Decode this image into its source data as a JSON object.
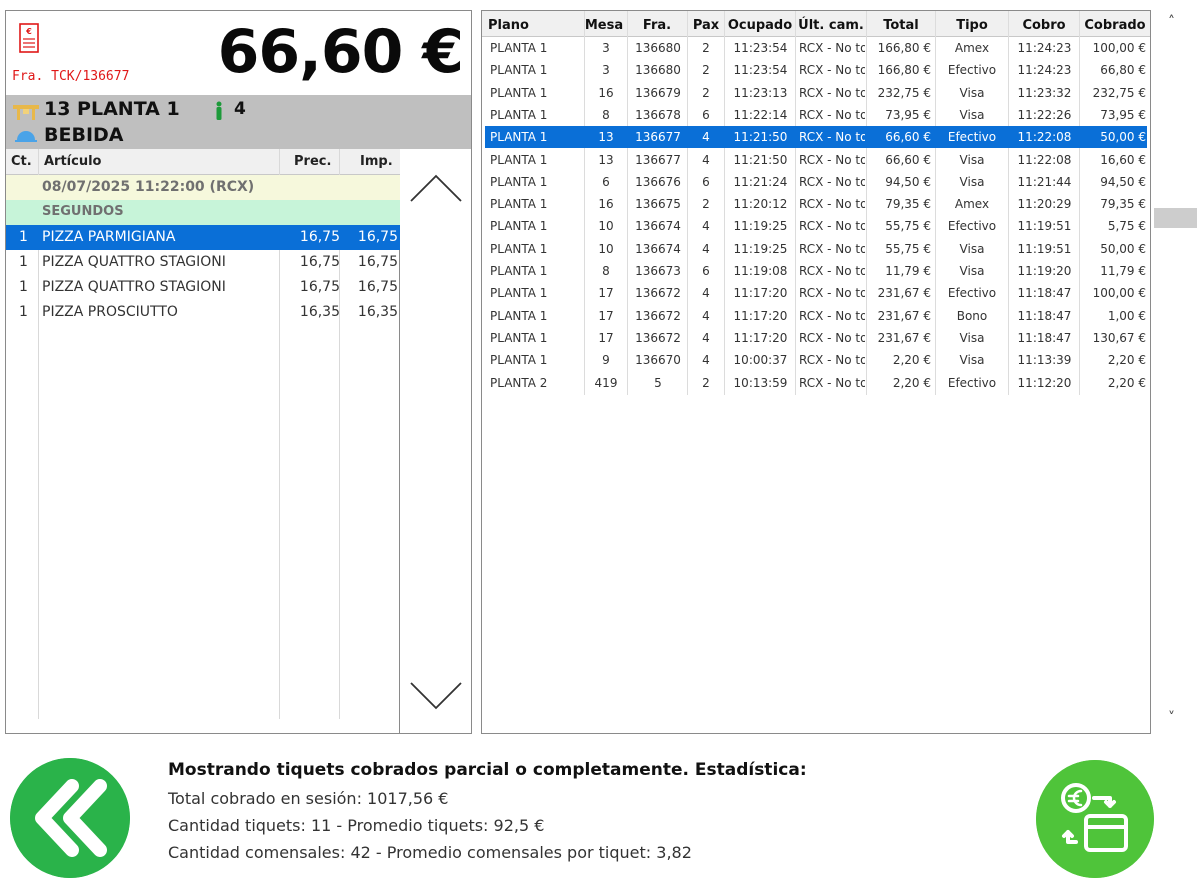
{
  "ticket": {
    "invoice_ref": "Fra. TCK/136677",
    "total": "66,60 €",
    "table_name": "13 PLANTA 1",
    "pax": "4",
    "category": "BEBIDA",
    "columns": {
      "qty": "Ct.",
      "item": "Artículo",
      "price": "Prec.",
      "amount": "Imp."
    },
    "date_line": "08/07/2025 11:22:00 (RCX)",
    "course_line": "SEGUNDOS",
    "lines": [
      {
        "qty": "1",
        "item": "PIZZA PARMIGIANA",
        "price": "16,75",
        "amount": "16,75",
        "selected": true
      },
      {
        "qty": "1",
        "item": "PIZZA QUATTRO STAGIONI",
        "price": "16,75",
        "amount": "16,75",
        "selected": false
      },
      {
        "qty": "1",
        "item": "PIZZA QUATTRO STAGIONI",
        "price": "16,75",
        "amount": "16,75",
        "selected": false
      },
      {
        "qty": "1",
        "item": "PIZZA PROSCIUTTO",
        "price": "16,35",
        "amount": "16,35",
        "selected": false
      }
    ]
  },
  "grid": {
    "headers": [
      "Plano",
      "Mesa",
      "Fra.",
      "Pax",
      "Ocupado",
      "Últ. cam.",
      "Total",
      "Tipo",
      "Cobro",
      "Cobrado"
    ],
    "rows": [
      [
        "PLANTA 1",
        "3",
        "136680",
        "2",
        "11:23:54",
        "RCX - No to",
        "166,80 €",
        "Amex",
        "11:24:23",
        "100,00 €"
      ],
      [
        "PLANTA 1",
        "3",
        "136680",
        "2",
        "11:23:54",
        "RCX - No to",
        "166,80 €",
        "Efectivo",
        "11:24:23",
        "66,80 €"
      ],
      [
        "PLANTA 1",
        "16",
        "136679",
        "2",
        "11:23:13",
        "RCX - No to",
        "232,75 €",
        "Visa",
        "11:23:32",
        "232,75 €"
      ],
      [
        "PLANTA 1",
        "8",
        "136678",
        "6",
        "11:22:14",
        "RCX - No to",
        "73,95 €",
        "Visa",
        "11:22:26",
        "73,95 €"
      ],
      [
        "PLANTA 1",
        "13",
        "136677",
        "4",
        "11:21:50",
        "RCX - No to",
        "66,60 €",
        "Efectivo",
        "11:22:08",
        "50,00 €"
      ],
      [
        "PLANTA 1",
        "13",
        "136677",
        "4",
        "11:21:50",
        "RCX - No to",
        "66,60 €",
        "Visa",
        "11:22:08",
        "16,60 €"
      ],
      [
        "PLANTA 1",
        "6",
        "136676",
        "6",
        "11:21:24",
        "RCX - No to",
        "94,50 €",
        "Visa",
        "11:21:44",
        "94,50 €"
      ],
      [
        "PLANTA 1",
        "16",
        "136675",
        "2",
        "11:20:12",
        "RCX - No to",
        "79,35 €",
        "Amex",
        "11:20:29",
        "79,35 €"
      ],
      [
        "PLANTA 1",
        "10",
        "136674",
        "4",
        "11:19:25",
        "RCX - No to",
        "55,75 €",
        "Efectivo",
        "11:19:51",
        "5,75 €"
      ],
      [
        "PLANTA 1",
        "10",
        "136674",
        "4",
        "11:19:25",
        "RCX - No to",
        "55,75 €",
        "Visa",
        "11:19:51",
        "50,00 €"
      ],
      [
        "PLANTA 1",
        "8",
        "136673",
        "6",
        "11:19:08",
        "RCX - No to",
        "11,79 €",
        "Visa",
        "11:19:20",
        "11,79 €"
      ],
      [
        "PLANTA 1",
        "17",
        "136672",
        "4",
        "11:17:20",
        "RCX - No to",
        "231,67 €",
        "Efectivo",
        "11:18:47",
        "100,00 €"
      ],
      [
        "PLANTA 1",
        "17",
        "136672",
        "4",
        "11:17:20",
        "RCX - No to",
        "231,67 €",
        "Bono",
        "11:18:47",
        "1,00 €"
      ],
      [
        "PLANTA 1",
        "17",
        "136672",
        "4",
        "11:17:20",
        "RCX - No to",
        "231,67 €",
        "Visa",
        "11:18:47",
        "130,67 €"
      ],
      [
        "PLANTA 1",
        "9",
        "136670",
        "4",
        "10:00:37",
        "RCX - No to",
        "2,20 €",
        "Visa",
        "11:13:39",
        "2,20 €"
      ],
      [
        "PLANTA 2",
        "419",
        "5",
        "2",
        "10:13:59",
        "RCX - No to",
        "2,20 €",
        "Efectivo",
        "11:12:20",
        "2,20 €"
      ]
    ],
    "selected_row": 4
  },
  "stats": {
    "title": "Mostrando tiquets cobrados parcial o completamente. Estadística:",
    "total_collected": "Total cobrado en sesión: 1017,56 €",
    "ticket_count": "Cantidad tiquets: 11 - Promedio tiquets: 92,5 €",
    "diners": "Cantidad comensales: 42 - Promedio comensales por tiquet: 3,82"
  },
  "icons": {
    "ticket": "receipt-icon",
    "table": "table-icon",
    "person": "person-icon",
    "category": "cloche-icon",
    "scroll_up": "chevron-up-icon",
    "scroll_down": "chevron-down-icon",
    "back": "double-chevron-left-icon",
    "pay": "payment-exchange-icon"
  },
  "colors": {
    "selection": "#0a6fd7",
    "invoice_ref": "#e01818",
    "back_button": "#2ab34a",
    "pay_button": "#4fc43a",
    "course_row": "#c7f4d9",
    "date_row": "#f6f8dc"
  }
}
